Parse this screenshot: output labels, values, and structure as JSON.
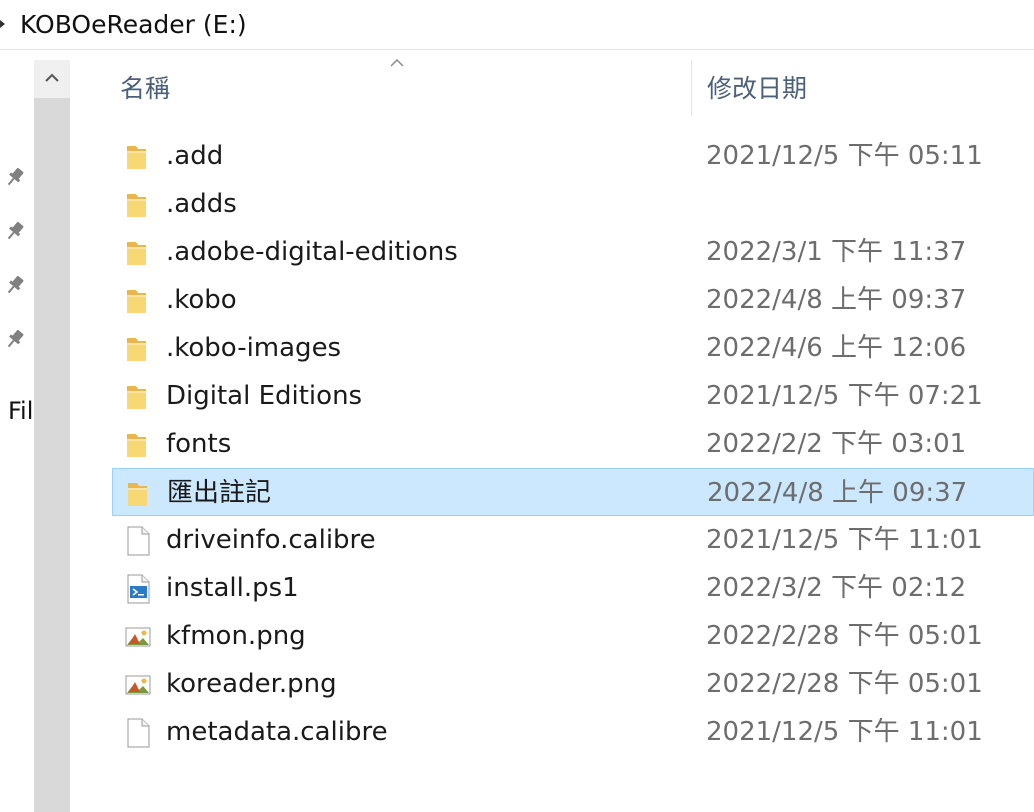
{
  "address": {
    "path": "KOBOeReader (E:)"
  },
  "nav": {
    "partial_label": "Fil"
  },
  "columns": {
    "name": "名稱",
    "date": "修改日期"
  },
  "files": [
    {
      "name": ".add",
      "date": "2021/12/5 下午 05:11",
      "icon": "folder-icon",
      "selected": false
    },
    {
      "name": ".adds",
      "date": "",
      "icon": "folder-icon",
      "selected": false
    },
    {
      "name": ".adobe-digital-editions",
      "date": "2022/3/1 下午 11:37",
      "icon": "folder-icon",
      "selected": false
    },
    {
      "name": ".kobo",
      "date": "2022/4/8 上午 09:37",
      "icon": "folder-icon",
      "selected": false
    },
    {
      "name": ".kobo-images",
      "date": "2022/4/6 上午 12:06",
      "icon": "folder-icon",
      "selected": false
    },
    {
      "name": "Digital Editions",
      "date": "2021/12/5 下午 07:21",
      "icon": "folder-icon",
      "selected": false
    },
    {
      "name": "fonts",
      "date": "2022/2/2 下午 03:01",
      "icon": "folder-icon",
      "selected": false
    },
    {
      "name": "匯出註記",
      "date": "2022/4/8 上午 09:37",
      "icon": "folder-icon",
      "selected": true
    },
    {
      "name": "driveinfo.calibre",
      "date": "2021/12/5 下午 11:01",
      "icon": "file-icon",
      "selected": false
    },
    {
      "name": "install.ps1",
      "date": "2022/3/2 下午 02:12",
      "icon": "powershell-script-icon",
      "selected": false
    },
    {
      "name": "kfmon.png",
      "date": "2022/2/28 下午 05:01",
      "icon": "image-file-icon",
      "selected": false
    },
    {
      "name": "koreader.png",
      "date": "2022/2/28 下午 05:01",
      "icon": "image-file-icon",
      "selected": false
    },
    {
      "name": "metadata.calibre",
      "date": "2021/12/5 下午 11:01",
      "icon": "file-icon",
      "selected": false
    }
  ],
  "colors": {
    "selection_bg": "#cce8ff",
    "selection_border": "#99d1ff",
    "header_text": "#4c607a",
    "folder_yellow": "#f8d775"
  }
}
